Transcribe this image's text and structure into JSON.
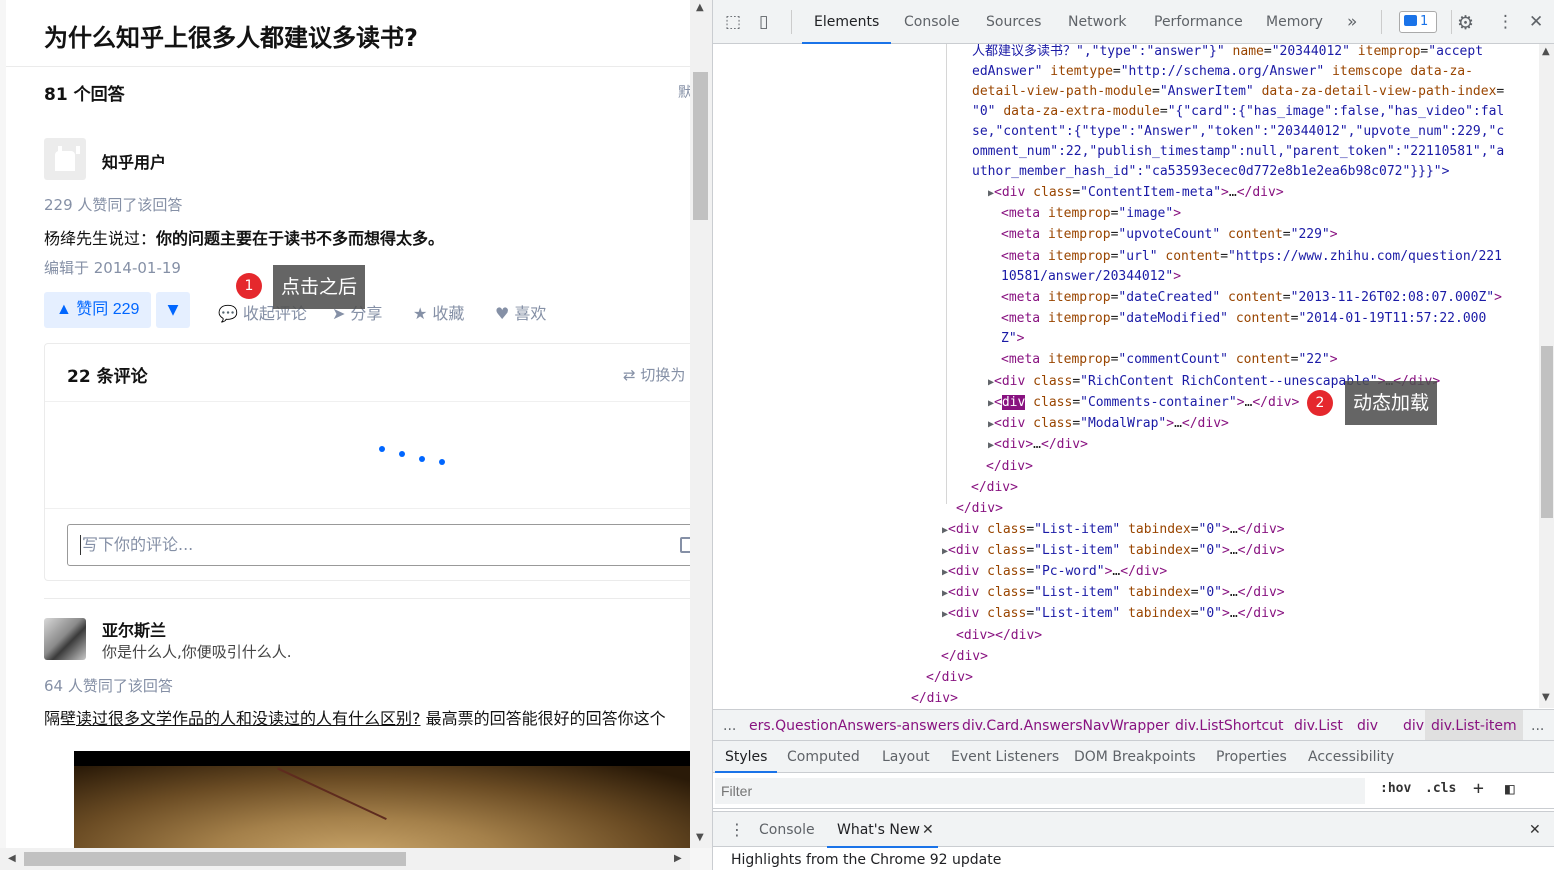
{
  "zhihu": {
    "question_title": "为什么知乎上很多人都建议多读书?",
    "answer_count": "81 个回答",
    "sort_cutoff": "默",
    "answer1": {
      "author": "知乎用户",
      "votes": "229 人赞同了该回答",
      "content_prefix": "杨绛先生说过：",
      "content_bold": "你的问题主要在于读书不多而想得太多。",
      "edited": "编辑于 2014-01-19",
      "upvote_label": "▲ 赞同 229",
      "downvote_label": "▼",
      "collapse_comments": "收起评论",
      "share": "分享",
      "favorite": "收藏",
      "like": "喜欢"
    },
    "comments": {
      "title": "22 条评论",
      "switch": "切换为",
      "placeholder": "写下你的评论..."
    },
    "answer2": {
      "author": "亚尔斯兰",
      "bio": "你是什么人,你便吸引什么人.",
      "votes": "64 人赞同了该回答",
      "text_pre": "隔壁",
      "text_link": "读过很多文学作品的人和没读过的人有什么区别?",
      "text_post": " 最高票的回答能很好的回答你这个"
    },
    "bottom_overlay": "\"……………………………………\""
  },
  "callouts": {
    "c1": {
      "num": "1",
      "text": "点击之后"
    },
    "c2": {
      "num": "2",
      "text": "动态加载"
    }
  },
  "devtools": {
    "tabs": [
      "Elements",
      "Console",
      "Sources",
      "Network",
      "Performance",
      "Memory"
    ],
    "more_tabs": "»",
    "issues_count": "1",
    "code": {
      "l1_text": "人都建议多读书？\",\"type\":\"answer\"}\"",
      "l1_a1n": "name",
      "l1_a1v": "\"20344012\"",
      "l1_a2n": "itemprop",
      "l1_a2v": "\"accept",
      "l2_a2v": "edAnswer\"",
      "l2_a3n": "itemtype",
      "l2_a3v": "\"http://schema.org/Answer\"",
      "l2_a4n": "itemscope",
      "l2_a5n": "data-za-",
      "l3_a5n": "detail-view-path-module",
      "l3_a5v": "\"AnswerItem\"",
      "l3_a6n": "data-za-detail-view-path-index",
      "l4_a6v": "\"0\"",
      "l4_a7n": "data-za-extra-module",
      "l4_a7v": "\"{\"card\":{\"has_image\":false,\"has_video\":fal",
      "l5": "se,\"content\":{\"type\":\"Answer\",\"token\":\"20344012\",\"upvote_num\":229,\"c",
      "l6": "omment_num\":22,\"publish_timestamp\":null,\"parent_token\":\"22110581\",\"a",
      "l7": "uthor_member_hash_id\":\"ca53593ecec0d772e8b1e2ea6b98c072\"}}}\">",
      "meta_class": "\"ContentItem-meta\"",
      "m1n": "\"image\"",
      "m2n": "\"upvoteCount\"",
      "m2c": "\"229\"",
      "m3n": "\"url\"",
      "m3c": "\"https://www.zhihu.com/question/221",
      "m3c2": "10581/answer/20344012\"",
      "m4n": "\"dateCreated\"",
      "m4c": "\"2013-11-26T02:08:07.000Z\"",
      "m5n": "\"dateModified\"",
      "m5c": "\"2014-01-19T11:57:22.000",
      "m5c2": "Z\"",
      "m6n": "\"commentCount\"",
      "m6c": "\"22\"",
      "rc_class": "\"RichContent RichContent--unescapable\"",
      "cc_class": "\"Comments-container\"",
      "mw_class": "\"ModalWrap\"",
      "li_class": "\"List-item\"",
      "li_tab": "\"0\"",
      "pw_class": "\"Pc-word\""
    },
    "breadcrumbs": [
      "...",
      "ers.QuestionAnswers-answers",
      "div.Card.AnswersNavWrapper",
      "div.ListShortcut",
      "div.List",
      "div",
      "div",
      "div.List-item",
      "..."
    ],
    "subtabs": [
      "Styles",
      "Computed",
      "Layout",
      "Event Listeners",
      "DOM Breakpoints",
      "Properties",
      "Accessibility"
    ],
    "filter_placeholder": "Filter",
    "hov": ":hov",
    "cls": ".cls",
    "drawer_tabs": [
      "Console",
      "What's New"
    ],
    "whats_new_line": "Highlights from the Chrome 92 update"
  }
}
